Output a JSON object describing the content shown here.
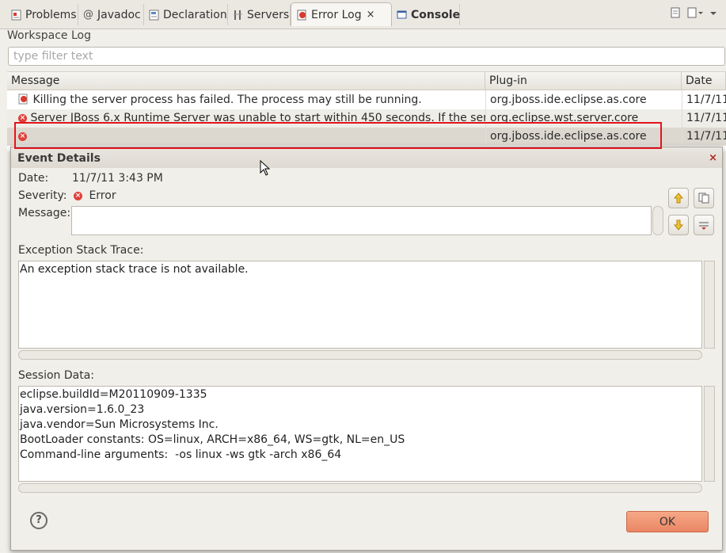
{
  "tabs": [
    {
      "label": "Problems",
      "icon": "problems-icon"
    },
    {
      "label": "Javadoc",
      "icon": "@"
    },
    {
      "label": "Declaration",
      "icon": "declaration-icon"
    },
    {
      "label": "Servers",
      "icon": "servers-icon"
    },
    {
      "label": "Error Log",
      "icon": "error-log-icon",
      "close": "×"
    },
    {
      "label": "Console",
      "icon": "console-icon"
    }
  ],
  "workspace_log": "Workspace Log",
  "filter": {
    "placeholder": "type filter text"
  },
  "table": {
    "headers": [
      "Message",
      "Plug-in",
      "Date"
    ],
    "rows": [
      {
        "message": "Killing the server process has failed. The process may still be running.",
        "plugin": "org.jboss.ide.eclipse.as.core",
        "date": "11/7/11"
      },
      {
        "message": "Server JBoss 6.x Runtime Server was unable to start within 450 seconds. If the server r",
        "plugin": "org.eclipse.wst.server.core",
        "date": "11/7/11"
      },
      {
        "message": "",
        "plugin": "org.jboss.ide.eclipse.as.core",
        "date": "11/7/11"
      }
    ]
  },
  "dialog": {
    "title": "Event Details",
    "close": "×",
    "date_label": "Date:",
    "date_value": "11/7/11 3:43 PM",
    "severity_label": "Severity:",
    "severity_value": "Error",
    "message_label": "Message:",
    "message_value": "",
    "stack_label": "Exception Stack Trace:",
    "stack_value": "An exception stack trace is not available.",
    "session_label": "Session Data:",
    "session_lines": [
      "eclipse.buildId=M20110909-1335",
      "java.version=1.6.0_23",
      "java.vendor=Sun Microsystems Inc.",
      "BootLoader constants: OS=linux, ARCH=x86_64, WS=gtk, NL=en_US",
      "Command-line arguments:  -os linux -ws gtk -arch x86_64"
    ],
    "help": "?",
    "ok_label": "OK"
  },
  "colors": {
    "accent_red": "#e3141c",
    "ok_button": "#ec8a68",
    "error": "#e0403a"
  }
}
